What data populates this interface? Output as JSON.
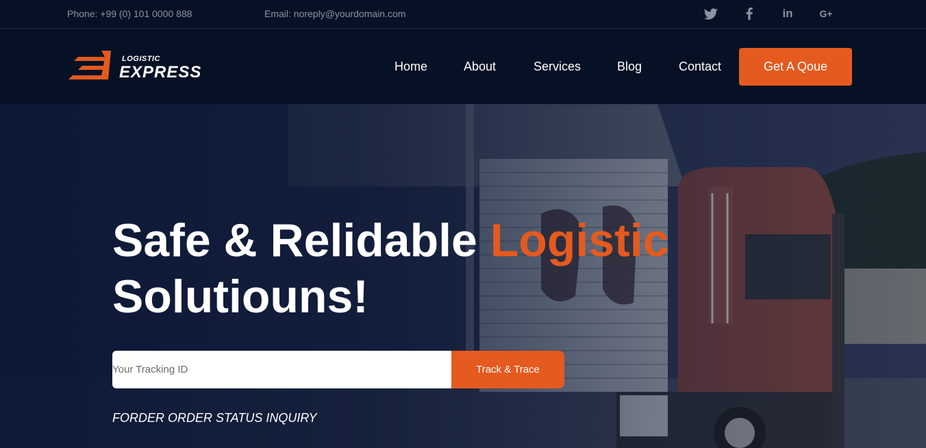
{
  "topbar": {
    "phone": "Phone: +99 (0) 101 0000 888",
    "email": "Email: noreply@yourdomain.com",
    "socials": [
      {
        "icon": "twitter-icon"
      },
      {
        "icon": "facebook-icon"
      },
      {
        "icon": "linkedin-icon",
        "text": "in"
      },
      {
        "icon": "google-plus-icon",
        "text": "G+"
      }
    ]
  },
  "brand": {
    "top": "LOGISTIC",
    "main": "EXPRESS",
    "accent_color": "#e45a1f"
  },
  "nav": {
    "items": [
      {
        "label": "Home"
      },
      {
        "label": "About"
      },
      {
        "label": "Services"
      },
      {
        "label": "Blog"
      },
      {
        "label": "Contact"
      }
    ],
    "cta": "Get A Qoue"
  },
  "hero": {
    "headline_part1": "Safe & Relidable ",
    "headline_accent": "Logistic",
    "headline_part2": "Solutiouns!",
    "tracking": {
      "placeholder": "Your Tracking ID",
      "value": "",
      "button": "Track & Trace"
    },
    "inquiry": "FORDER ORDER STATUS INQUIRY"
  },
  "colors": {
    "background": "#061125",
    "accent": "#e45a1f",
    "text_muted": "#8a93a3"
  }
}
